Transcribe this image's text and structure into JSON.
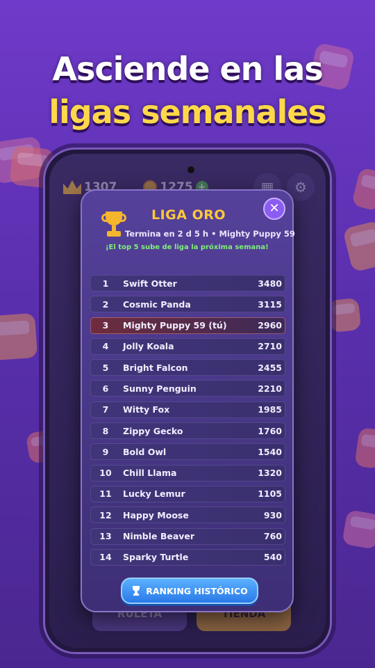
{
  "headline": {
    "line1": "Asciende en las",
    "line2": "ligas semanales"
  },
  "hud": {
    "crowns": "1307",
    "coins": "1275",
    "plus": "+",
    "grid_icon": "grid-icon",
    "gear_icon": "gear-icon"
  },
  "background_buttons": {
    "left_label": "RULETA",
    "right_label": "TIENDA"
  },
  "modal": {
    "title": "LIGA ORO",
    "subinfo": "Termina en 2 d 5 h  •  Mighty Puppy 59",
    "promo": "¡El top 5 sube de liga la próxima semana!",
    "close": "✕",
    "history_button": "RANKING HISTÓRICO",
    "rows": [
      {
        "rank": "1",
        "name": "Swift Otter",
        "score": "3480"
      },
      {
        "rank": "2",
        "name": "Cosmic Panda",
        "score": "3115"
      },
      {
        "rank": "3",
        "name": "Mighty Puppy 59 (tú)",
        "score": "2960"
      },
      {
        "rank": "4",
        "name": "Jolly Koala",
        "score": "2710"
      },
      {
        "rank": "5",
        "name": "Bright Falcon",
        "score": "2455"
      },
      {
        "rank": "6",
        "name": "Sunny Penguin",
        "score": "2210"
      },
      {
        "rank": "7",
        "name": "Witty Fox",
        "score": "1985"
      },
      {
        "rank": "8",
        "name": "Zippy Gecko",
        "score": "1760"
      },
      {
        "rank": "9",
        "name": "Bold Owl",
        "score": "1540"
      },
      {
        "rank": "10",
        "name": "Chill Llama",
        "score": "1320"
      },
      {
        "rank": "11",
        "name": "Lucky Lemur",
        "score": "1105"
      },
      {
        "rank": "12",
        "name": "Happy Moose",
        "score": "930"
      },
      {
        "rank": "13",
        "name": "Nimble Beaver",
        "score": "760"
      },
      {
        "rank": "14",
        "name": "Sparky Turtle",
        "score": "540"
      }
    ]
  },
  "colors": {
    "accent_gold": "#ffc93c",
    "promo_green": "#7ef07a",
    "button_blue": "#2a7ae8",
    "close_purple": "#8b5cf0"
  }
}
